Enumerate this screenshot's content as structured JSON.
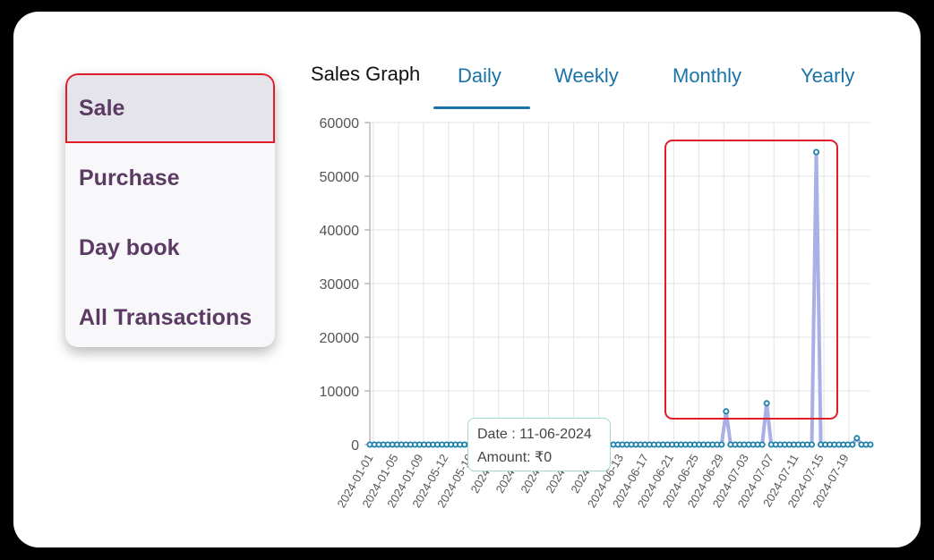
{
  "menu": {
    "items": [
      {
        "label": "Sale",
        "active": true
      },
      {
        "label": "Purchase",
        "active": false
      },
      {
        "label": "Day book",
        "active": false
      },
      {
        "label": "All Transactions",
        "active": false
      }
    ]
  },
  "graph": {
    "title": "Sales Graph",
    "tabs": [
      "Daily",
      "Weekly",
      "Monthly",
      "Yearly"
    ],
    "active_tab": "Daily"
  },
  "tooltip": {
    "date": "Date : 11-06-2024",
    "amount": "Amount: ₹0"
  },
  "colors": {
    "line": "#a9b0e6",
    "point": "#1a7fa8",
    "highlight_box": "#e11d2a",
    "menu_text": "#5b3a63",
    "tab_text": "#1a73a8"
  },
  "chart_data": {
    "type": "line",
    "title": "",
    "xlabel": "",
    "ylabel": "",
    "ylim": [
      0,
      60000
    ],
    "yticks": [
      0,
      10000,
      20000,
      30000,
      40000,
      50000,
      60000
    ],
    "grid": true,
    "xtick_labels": [
      "2024-01-01",
      "2024-01-05",
      "2024-01-09",
      "2024-05-12",
      "2024-05-16",
      "2024-05",
      "2024-05",
      "2024-06",
      "2024-06",
      "2024-06",
      "2024-06-13",
      "2024-06-17",
      "2024-06-21",
      "2024-06-25",
      "2024-06-29",
      "2024-07-03",
      "2024-07-07",
      "2024-07-11",
      "2024-07-15",
      "2024-07-19"
    ],
    "values": [
      0,
      0,
      0,
      0,
      0,
      0,
      0,
      0,
      0,
      0,
      0,
      0,
      0,
      0,
      0,
      0,
      0,
      0,
      0,
      0,
      0,
      0,
      0,
      0,
      0,
      0,
      0,
      0,
      0,
      0,
      0,
      0,
      0,
      0,
      0,
      0,
      0,
      0,
      0,
      0,
      0,
      0,
      0,
      0,
      0,
      0,
      0,
      0,
      0,
      0,
      0,
      0,
      0,
      0,
      0,
      0,
      0,
      0,
      0,
      0,
      0,
      0,
      0,
      0,
      0,
      0,
      0,
      0,
      0,
      0,
      0,
      0,
      0,
      0,
      0,
      0,
      0,
      0,
      0,
      6200,
      0,
      0,
      0,
      0,
      0,
      0,
      0,
      0,
      7700,
      0,
      0,
      0,
      0,
      0,
      0,
      0,
      0,
      0,
      0,
      54500,
      0,
      0,
      0,
      0,
      0,
      0,
      0,
      0,
      1200,
      0,
      0,
      0
    ]
  }
}
